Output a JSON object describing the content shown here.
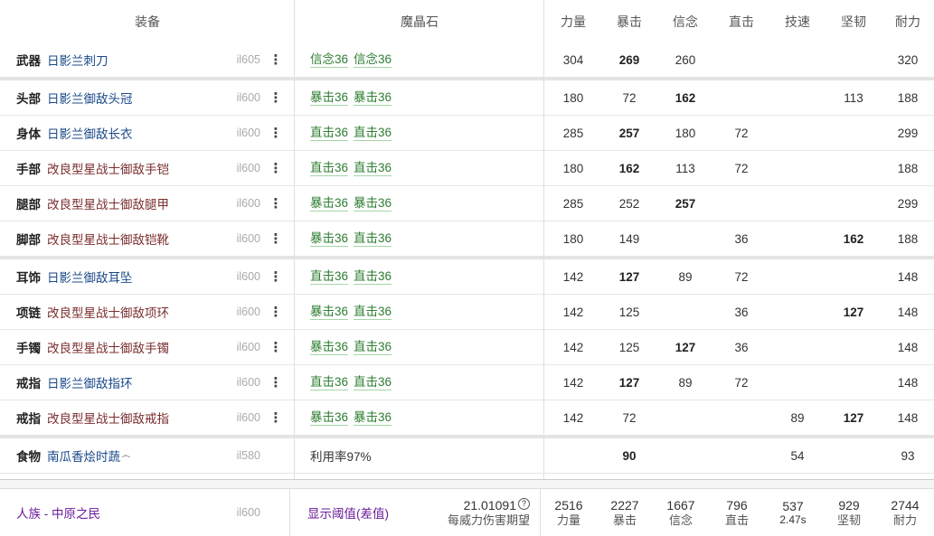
{
  "header": {
    "gear": "装备",
    "materia": "魔晶石",
    "stats": [
      "力量",
      "暴击",
      "信念",
      "直击",
      "技速",
      "坚韧",
      "耐力"
    ]
  },
  "rows": [
    {
      "slot": "武器",
      "item": "日影兰刺刀",
      "item_color": "blue",
      "ilvl": "il605",
      "more": "⋮",
      "melds": [
        "信念36",
        "信念36"
      ],
      "stats": [
        "304",
        "269",
        "260",
        "",
        "",
        "",
        "320"
      ],
      "bold": [
        1
      ],
      "group_end": true
    },
    {
      "slot": "头部",
      "item": "日影兰御敌头冠",
      "item_color": "blue",
      "ilvl": "il600",
      "more": "⋮",
      "melds": [
        "暴击36",
        "暴击36"
      ],
      "stats": [
        "180",
        "72",
        "162",
        "",
        "",
        "113",
        "188"
      ],
      "bold": [
        2
      ],
      "group_end": false
    },
    {
      "slot": "身体",
      "item": "日影兰御敌长衣",
      "item_color": "blue",
      "ilvl": "il600",
      "more": "⋮",
      "melds": [
        "直击36",
        "直击36"
      ],
      "stats": [
        "285",
        "257",
        "180",
        "72",
        "",
        "",
        "299"
      ],
      "bold": [
        1
      ],
      "group_end": false
    },
    {
      "slot": "手部",
      "item": "改良型星战士御敌手铠",
      "item_color": "maroon",
      "ilvl": "il600",
      "more": "⋮",
      "melds": [
        "直击36",
        "直击36"
      ],
      "stats": [
        "180",
        "162",
        "113",
        "72",
        "",
        "",
        "188"
      ],
      "bold": [
        1
      ],
      "group_end": false
    },
    {
      "slot": "腿部",
      "item": "改良型星战士御敌腿甲",
      "item_color": "maroon",
      "ilvl": "il600",
      "more": "⋮",
      "melds": [
        "暴击36",
        "暴击36"
      ],
      "stats": [
        "285",
        "252",
        "257",
        "",
        "",
        "",
        "299"
      ],
      "bold": [
        2
      ],
      "group_end": false
    },
    {
      "slot": "脚部",
      "item": "改良型星战士御敌铠靴",
      "item_color": "maroon",
      "ilvl": "il600",
      "more": "⋮",
      "melds": [
        "暴击36",
        "直击36"
      ],
      "stats": [
        "180",
        "149",
        "",
        "36",
        "",
        "162",
        "188"
      ],
      "bold": [
        5
      ],
      "group_end": true
    },
    {
      "slot": "耳饰",
      "item": "日影兰御敌耳坠",
      "item_color": "blue",
      "ilvl": "il600",
      "more": "⋮",
      "melds": [
        "直击36",
        "直击36"
      ],
      "stats": [
        "142",
        "127",
        "89",
        "72",
        "",
        "",
        "148"
      ],
      "bold": [
        1
      ],
      "group_end": false
    },
    {
      "slot": "项链",
      "item": "改良型星战士御敌项环",
      "item_color": "maroon",
      "ilvl": "il600",
      "more": "⋮",
      "melds": [
        "暴击36",
        "直击36"
      ],
      "stats": [
        "142",
        "125",
        "",
        "36",
        "",
        "127",
        "148"
      ],
      "bold": [
        5
      ],
      "group_end": false
    },
    {
      "slot": "手镯",
      "item": "改良型星战士御敌手镯",
      "item_color": "maroon",
      "ilvl": "il600",
      "more": "⋮",
      "melds": [
        "暴击36",
        "直击36"
      ],
      "stats": [
        "142",
        "125",
        "127",
        "36",
        "",
        "",
        "148"
      ],
      "bold": [
        2
      ],
      "group_end": false
    },
    {
      "slot": "戒指",
      "item": "日影兰御敌指环",
      "item_color": "blue",
      "ilvl": "il600",
      "more": "⋮",
      "melds": [
        "直击36",
        "直击36"
      ],
      "stats": [
        "142",
        "127",
        "89",
        "72",
        "",
        "",
        "148"
      ],
      "bold": [
        1
      ],
      "group_end": false
    },
    {
      "slot": "戒指",
      "item": "改良型星战士御敌戒指",
      "item_color": "maroon",
      "ilvl": "il600",
      "more": "⋮",
      "melds": [
        "暴击36",
        "暴击36"
      ],
      "stats": [
        "142",
        "72",
        "",
        "",
        "89",
        "127",
        "148"
      ],
      "bold": [
        5
      ],
      "group_end": true
    }
  ],
  "food": {
    "slot": "食物",
    "item": "南瓜香烩时蔬",
    "swirl": "෴",
    "ilvl": "il580",
    "note": "利用率97%",
    "stats": [
      "",
      "90",
      "",
      "",
      "54",
      "",
      "93"
    ],
    "bold": [
      1
    ]
  },
  "footer": {
    "race": "人族 - 中原之民",
    "ilvl": "il600",
    "threshold": "显示阈值(差值)",
    "dmg_value": "21.01091",
    "dmg_icon": "?",
    "dmg_label": "每威力伤害期望",
    "totals": [
      {
        "value": "2516",
        "label": "力量"
      },
      {
        "value": "2227",
        "label": "暴击"
      },
      {
        "value": "1667",
        "label": "信念"
      },
      {
        "value": "796",
        "label": "直击"
      },
      {
        "value": "537",
        "label": "2.47s"
      },
      {
        "value": "929",
        "label": "坚韧"
      },
      {
        "value": "2744",
        "label": "耐力"
      }
    ]
  },
  "colors": {
    "blue": "#1a4a8a",
    "maroon": "#7b2d2d",
    "meld": "#2e7d32",
    "purple": "#6a1b9a"
  }
}
